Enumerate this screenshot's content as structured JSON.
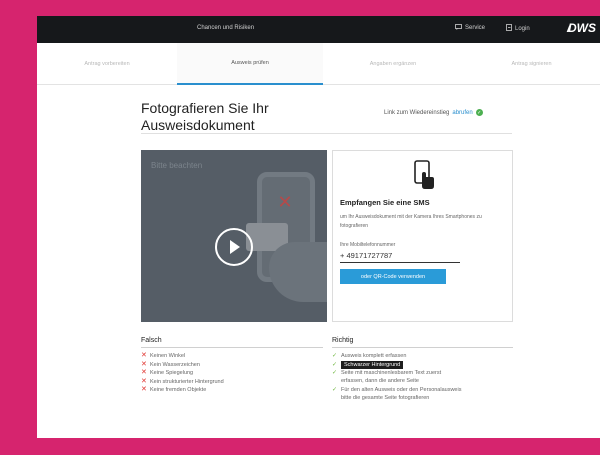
{
  "header": {
    "center_title": "Chancen und Risiken",
    "service_label": "Service",
    "login_label": "Login",
    "logo": "DWS"
  },
  "steps": [
    {
      "label": "Antrag vorbereiten",
      "active": false
    },
    {
      "label": "Ausweis prüfen",
      "active": true
    },
    {
      "label": "Angaben ergänzen",
      "active": false
    },
    {
      "label": "Antrag signieren",
      "active": false
    }
  ],
  "main": {
    "title_line1": "Fotografieren Sie Ihr",
    "title_line2": "Ausweisdokument",
    "restart_text": "Link zum Wiedereinstieg",
    "restart_link": "abrufen"
  },
  "video": {
    "note": "Bitte beachten"
  },
  "sms": {
    "heading": "Empfangen Sie eine SMS",
    "description": "um Ihr Ausweisdokument mit der Kamera Ihres Smartphones zu fotografieren",
    "phone_label": "Ihre Mobiltelefonnummer",
    "phone_value": "+ 49171727787",
    "qr_button": "oder QR-Code verwenden"
  },
  "wrong": {
    "title": "Falsch",
    "items": [
      "Keinen Winkel",
      "Kein Wasserzeichen",
      "Keine Spiegelung",
      "Kein strukturierter Hintergrund",
      "Keine fremden Objekte"
    ]
  },
  "right": {
    "title": "Richtig",
    "items": [
      "Ausweis komplett erfassen",
      "Schwarzer Hintergrund",
      "Seite mit maschinenlesbarem Text zuerst",
      "erfassen, dann die andere Seite",
      "Für den alten Ausweis oder den Personalausweis",
      "bitte die gesamte Seite fotografieren"
    ]
  },
  "colors": {
    "frame_border": "#d6246e",
    "topbar": "#16181b",
    "accent": "#2a9bd8",
    "error": "#e0322d",
    "success": "#6bb53a"
  }
}
